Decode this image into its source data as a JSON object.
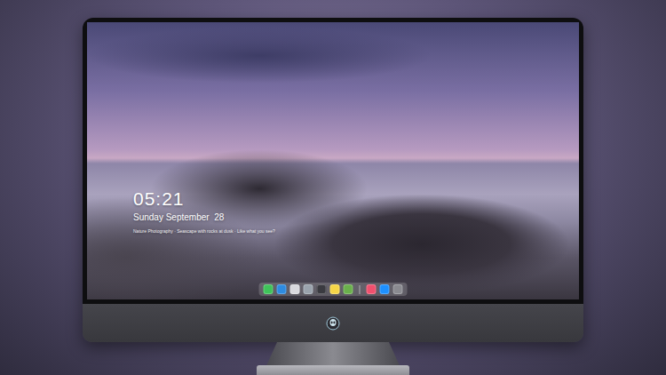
{
  "screen": {
    "time": "05:21",
    "date": "Sunday September  28",
    "caption": "Nature Photography · Seascape with rocks at dusk · Like what you see?"
  },
  "dock": {
    "apps": [
      {
        "color": "#3fc35a"
      },
      {
        "color": "#2e8be0"
      },
      {
        "color": "#d9d9de"
      },
      {
        "color": "#9aa3ad"
      },
      {
        "color": "#3a3a40"
      },
      {
        "color": "#f5d547"
      },
      {
        "color": "#6ab04c"
      }
    ],
    "pinned": [
      {
        "color": "#f0506e"
      },
      {
        "color": "#1e90ff"
      },
      {
        "color": "#8a8a90"
      }
    ]
  }
}
